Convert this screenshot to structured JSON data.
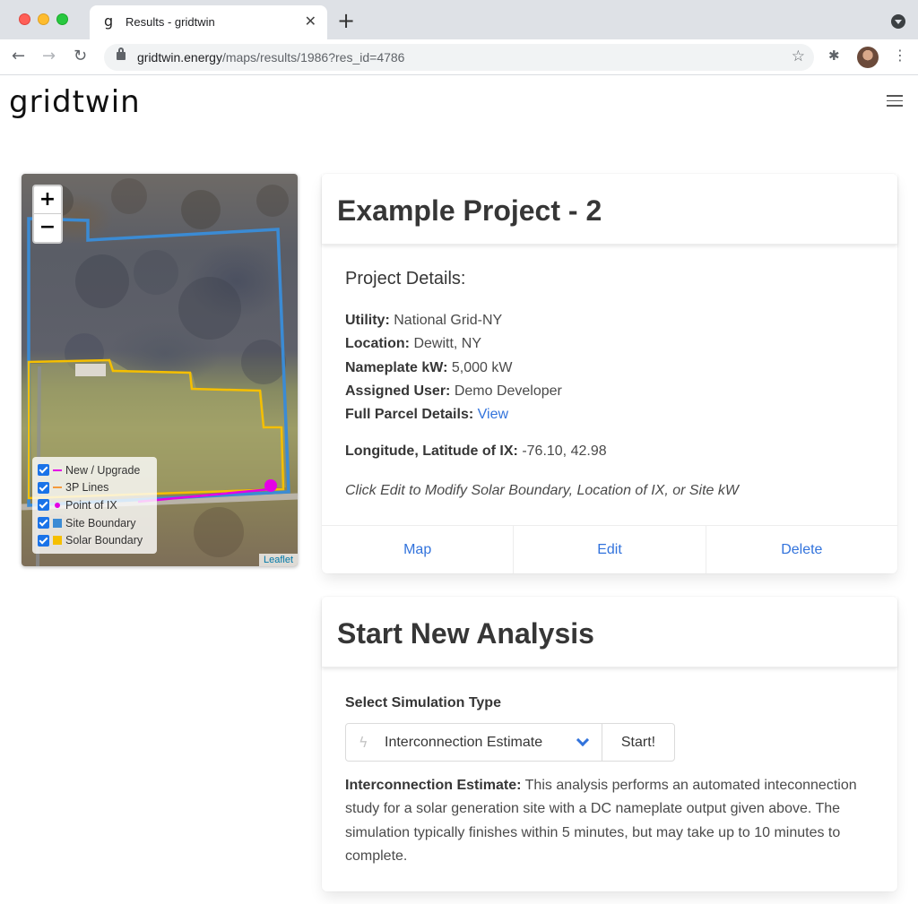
{
  "browser": {
    "tab_favicon": "g",
    "tab_title": "Results - gridtwin",
    "tab_close": "✕",
    "new_tab": "+",
    "url_host": "gridtwin.energy",
    "url_path": "/maps/results/1986?res_id=4786",
    "icons": [
      "back-arrow-icon",
      "forward-arrow-icon",
      "reload-icon",
      "lock-icon",
      "star-icon",
      "puzzle-icon",
      "avatar",
      "kebab-menu-icon"
    ]
  },
  "site": {
    "logo": "gridtwin"
  },
  "map": {
    "zoom_in": "+",
    "zoom_out": "−",
    "attribution": "Leaflet",
    "legend": [
      {
        "label": "New / Upgrade",
        "color": "#e500e5",
        "shape": "line"
      },
      {
        "label": "3P Lines",
        "color": "#f59a3b",
        "shape": "line"
      },
      {
        "label": "Point of IX",
        "color": "#e500e5",
        "shape": "dot"
      },
      {
        "label": "Site Boundary",
        "color": "#3b8bd4",
        "shape": "square"
      },
      {
        "label": "Solar Boundary",
        "color": "#f5bf00",
        "shape": "square"
      }
    ]
  },
  "project": {
    "title": "Example Project - 2",
    "details_heading": "Project Details:",
    "utility_label": "Utility:",
    "utility": "National Grid-NY",
    "location_label": "Location:",
    "location": "Dewitt, NY",
    "nameplate_label": "Nameplate kW:",
    "nameplate": "5,000 kW",
    "user_label": "Assigned User:",
    "user": "Demo Developer",
    "parcel_label": "Full Parcel Details:",
    "parcel_link": "View",
    "ix_label": "Longitude, Latitude of IX:",
    "ix_value": "-76.10, 42.98",
    "hint": "Click Edit to Modify Solar Boundary, Location of IX, or Site kW",
    "actions": {
      "map": "Map",
      "edit": "Edit",
      "delete": "Delete"
    }
  },
  "analysis": {
    "title": "Start New Analysis",
    "select_label": "Select Simulation Type",
    "selected": "Interconnection Estimate",
    "start": "Start!",
    "desc_label": "Interconnection Estimate:",
    "desc": "This analysis performs an automated inteconnection study for a solar generation site with a DC nameplate output given above. The simulation typically finishes within 5 minutes, but may take up to 10 minutes to complete."
  },
  "colors": {
    "accent": "#3273dc",
    "site_boundary": "#3b8bd4",
    "solar_boundary": "#f5bf00"
  }
}
